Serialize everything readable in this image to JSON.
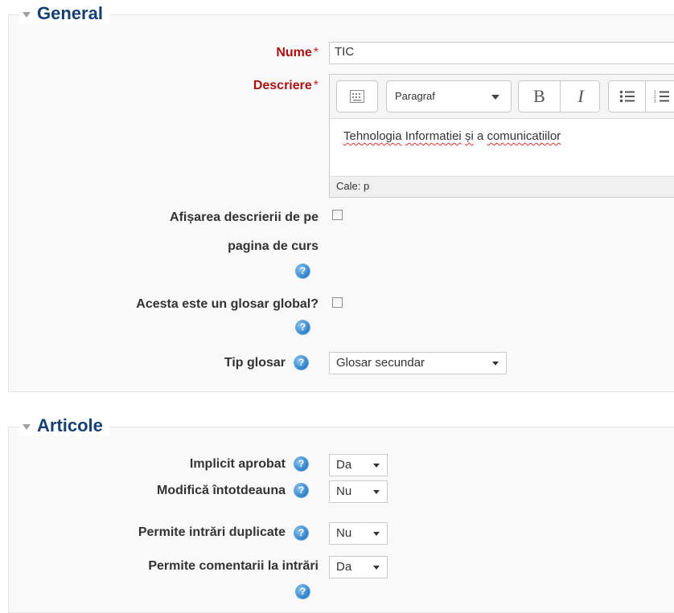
{
  "general": {
    "legend": "General",
    "name_label": "Nume",
    "required_mark": "*",
    "name_value": "TIC",
    "description_label": "Descriere",
    "editor": {
      "format_select": "Paragraf",
      "bold": "B",
      "italic": "I",
      "content_parts": [
        "Tehnologia",
        "Informatiei",
        "și",
        "a",
        "comunicatiilor"
      ],
      "path": "Cale: p"
    },
    "display_desc_label_line1": "Afișarea descrierii de pe",
    "display_desc_label_line2": "pagina de curs",
    "global_label": "Acesta este un glosar global?",
    "type_label": "Tip glosar",
    "type_value": "Glosar secundar"
  },
  "entries": {
    "legend": "Articole",
    "approved_label": "Implicit aprobat",
    "approved_value": "Da",
    "always_edit_label": "Modifică întotdeauna",
    "always_edit_value": "Nu",
    "duplicates_label": "Permite intrări duplicate",
    "duplicates_value": "Nu",
    "comments_label": "Permite comentarii la intrări",
    "comments_value": "Da"
  },
  "icons": {
    "help": "?",
    "help_color": "#2a7fc8",
    "legend_color": "#163f73",
    "required_color": "#aa1111"
  }
}
